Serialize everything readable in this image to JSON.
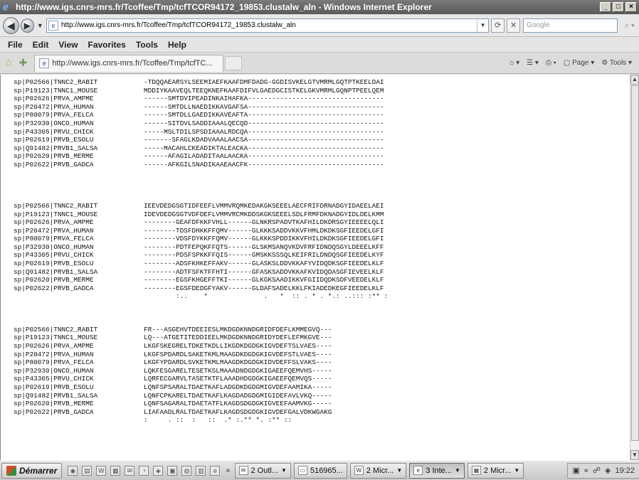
{
  "window": {
    "title": "http://www.igs.cnrs-mrs.fr/Tcoffee/Tmp/tcfTCOR94172_19853.clustalw_aln - Windows Internet Explorer",
    "controls": [
      "_",
      "□",
      "×"
    ]
  },
  "address_bar": {
    "url": "http://www.igs.cnrs-mrs.fr/Tcoffee/Tmp/tcfTCOR94172_19853.clustalw_aln",
    "search_placeholder": "Google"
  },
  "menu": [
    "File",
    "Edit",
    "View",
    "Favorites",
    "Tools",
    "Help"
  ],
  "tab": {
    "label": "http://www.igs.cnrs-mrs.fr/Tcoffee/Tmp/tcfTC..."
  },
  "command_bar": {
    "page_label": "Page",
    "tools_label": "Tools"
  },
  "alignment": {
    "blocks": [
      {
        "rows": [
          {
            "name": "sp|P02566|TNNC2_RABIT",
            "seq": "-TDQQAEARSYLSEEMIAEFKAAFDMFDADG-GGDISVKELGTVMRMLGQTPTKEELDAI"
          },
          {
            "name": "sp|P19123|TNNC1_MOUSE",
            "seq": "MDDIYKAAVEQLTEEQKNEFKAAFDIFVLGAEDGCISTKELGKVMRMLGQNPTPEELQEM"
          },
          {
            "name": "sp|P02626|PRVA_AMPME",
            "seq": "------SMTDVIPEADINKAIHAFKA----------------------------------"
          },
          {
            "name": "sp|P20472|PRVA_HUMAN",
            "seq": "------SMTDLLNAEDIKKAVGAFSA----------------------------------"
          },
          {
            "name": "sp|P80079|PRVA_FELCA",
            "seq": "------SMTDLLGAEDIKKAVEAFTA----------------------------------"
          },
          {
            "name": "sp|P32930|ONCO_HUMAN",
            "seq": "------SITDVLSADDIAAALQECQD----------------------------------"
          },
          {
            "name": "sp|P43305|PRVU_CHICK",
            "seq": "-----MSLTDILSPSDIAAALRDCQA----------------------------------"
          },
          {
            "name": "sp|P02619|PRVB_ESOLU",
            "seq": "-------SFAGLKDADVAAALAACSA----------------------------------"
          },
          {
            "name": "sp|Q91482|PRVB1_SALSA",
            "seq": "-----MACAHLCKEADIKTALEACKA----------------------------------"
          },
          {
            "name": "sp|P02620|PRVB_MERME",
            "seq": "------AFAGILADADITAALAACKA----------------------------------"
          },
          {
            "name": "sp|P02622|PRVB_GADCA",
            "seq": "------AFKGILSNADIKAAEAACFK----------------------------------"
          }
        ],
        "consensus": ""
      },
      {
        "rows": [
          {
            "name": "sp|P02566|TNNC2_RABIT",
            "seq": "IEEVDEDGSGTIDFEEFLVMMVRQMKEDAKGKSEEELAECFRIFDRNADGYIDAEELAEI"
          },
          {
            "name": "sp|P19123|TNNC1_MOUSE",
            "seq": "IDEVDEDGSGTVDFDEFLVMMVRCMKDDSKGKSEEELSDLFRMFDKNADGYIDLDELKMM"
          },
          {
            "name": "sp|P02626|PRVA_AMPME",
            "seq": "--------GEAFDFKKFVHLL------GLNKRSPADVTKAFHILDKDRSGYIEEEELQLI"
          },
          {
            "name": "sp|P20472|PRVA_HUMAN",
            "seq": "--------TDSFDHKKFFQMV------GLKKKSADDVKKVFHMLDKDKSGFIEEDELGFI"
          },
          {
            "name": "sp|P80079|PRVA_FELCA",
            "seq": "--------VDSFDYKKFFQMV------GLKKKSPDDIKKVFHILDKDKSGFIEEDELGFI"
          },
          {
            "name": "sp|P32930|ONCO_HUMAN",
            "seq": "--------PDTFEPQKFFQTS------GLSKMSANQVKDVFRFIDNDQSGYLDEEELKFF"
          },
          {
            "name": "sp|P43305|PRVU_CHICK",
            "seq": "--------PDSFSPKKFFQIS------GMSKKSSSQLKEIFRILDNDQSGFIEEDELKYF"
          },
          {
            "name": "sp|P02619|PRVB_ESOLU",
            "seq": "--------ADSFKHKEFFAKV------GLASKSLDDVKKAFYVIDQDKSGFIEEDELKLF"
          },
          {
            "name": "sp|Q91482|PRVB1_SALSA",
            "seq": "--------ADTFSFKTFFHTI------GFASKSADDVKKAFKVIDQDASGFIEVEELKLF"
          },
          {
            "name": "sp|P02620|PRVB_MERME",
            "seq": "--------EGSFKHGEFFTKI------GLKGKSAADIKKVFGIIDQDKSDFVEEDELKLF"
          },
          {
            "name": "sp|P02622|PRVB_GADCA",
            "seq": "--------EGSFDEDGFYAKV------GLDAFSADELKKLFKIADEDKEGFIEEDELKLF"
          }
        ],
        "consensus": "        :..    *              .   *  :: . * . *.: ..::: :** :"
      },
      {
        "rows": [
          {
            "name": "sp|P02566|TNNC2_RABIT",
            "seq": "FR---ASGEHVTDEEIESLMKDGDKNNDGRIDFDEFLKMMEGVQ---"
          },
          {
            "name": "sp|P19123|TNNC1_MOUSE",
            "seq": "LQ---ATGETITEDDIEELMKDGDKNNDGRIDYDEFLEFMKGVE---"
          },
          {
            "name": "sp|P02626|PRVA_AMPME",
            "seq": "LKGFSKEGRELTDKETKDLLIKGDKDGDGKIGVDEFTSLVAES----"
          },
          {
            "name": "sp|P20472|PRVA_HUMAN",
            "seq": "LKGFSPDARDLSAKETKMLMAAGDKDGDGKIGVDEFSTLVAES----"
          },
          {
            "name": "sp|P80079|PRVA_FELCA",
            "seq": "LKGFYPDARDLSVKETKMLMAAGDKDGDGKIDVDEFFSLVAKS----"
          },
          {
            "name": "sp|P32930|ONCO_HUMAN",
            "seq": "LQKFESGARELTESETKSLMAAADNDGDGKIGAEEFQEMVHS-----"
          },
          {
            "name": "sp|P43305|PRVU_CHICK",
            "seq": "LQRFECGARVLTASETKTFLAAADHDGDGKIGAEEFQEMVQS-----"
          },
          {
            "name": "sp|P02619|PRVB_ESOLU",
            "seq": "LQNFSPSARALTDAETKAFLADGDKDGDGMIGVDEFAAMIKA-----"
          },
          {
            "name": "sp|Q91482|PRVB1_SALSA",
            "seq": "LQNFCPKARELTDAETKAFLKAGDADGDGMIGIDEFAVLVKQ-----"
          },
          {
            "name": "sp|P02620|PRVB_MERME",
            "seq": "LQNFSAGARALTDAETATFLKAGDSDGDGKIGVEEFAAMVKG-----"
          },
          {
            "name": "sp|P02622|PRVB_GADCA",
            "seq": "LIAFAADLRALTDAETKAFLKAGDSDGDGKIGVDEFGALVDKWGAKG"
          }
        ],
        "consensus": ":     . ::  :   ::  .* :.** *. :** ::"
      }
    ]
  },
  "taskbar": {
    "start_label": "Démarrer",
    "chevron": "»",
    "buttons": [
      {
        "label": "2 Outl...",
        "active": false
      },
      {
        "label": "516965...",
        "active": false
      },
      {
        "label": "2 Micr...",
        "active": false
      },
      {
        "label": "3 Inte...",
        "active": true
      },
      {
        "label": "2 Micr...",
        "active": false
      }
    ],
    "clock": "19:22"
  }
}
